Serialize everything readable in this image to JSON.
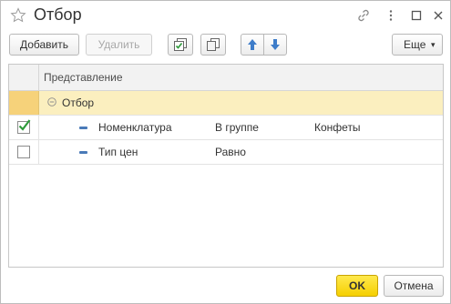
{
  "window": {
    "title": "Отбор"
  },
  "toolbar": {
    "add_label": "Добавить",
    "delete_label": "Удалить",
    "more_label": "Еще",
    "icons": [
      "check-all-icon",
      "copy-icon",
      "move-up-icon",
      "move-down-icon"
    ]
  },
  "grid": {
    "header": "Представление",
    "group": {
      "label": "Отбор"
    },
    "rows": [
      {
        "checked": true,
        "field": "Номенклатура",
        "condition": "В группе",
        "value": "Конфеты"
      },
      {
        "checked": false,
        "field": "Тип цен",
        "condition": "Равно",
        "value": ""
      }
    ]
  },
  "footer": {
    "ok_label": "OK",
    "cancel_label": "Отмена"
  },
  "colors": {
    "ok_button": "#f5cf00",
    "selected_row": "#fbefbf",
    "selected_cell": "#f6d27a",
    "check": "#2e9a3a",
    "arrow": "#3d7cc9"
  }
}
